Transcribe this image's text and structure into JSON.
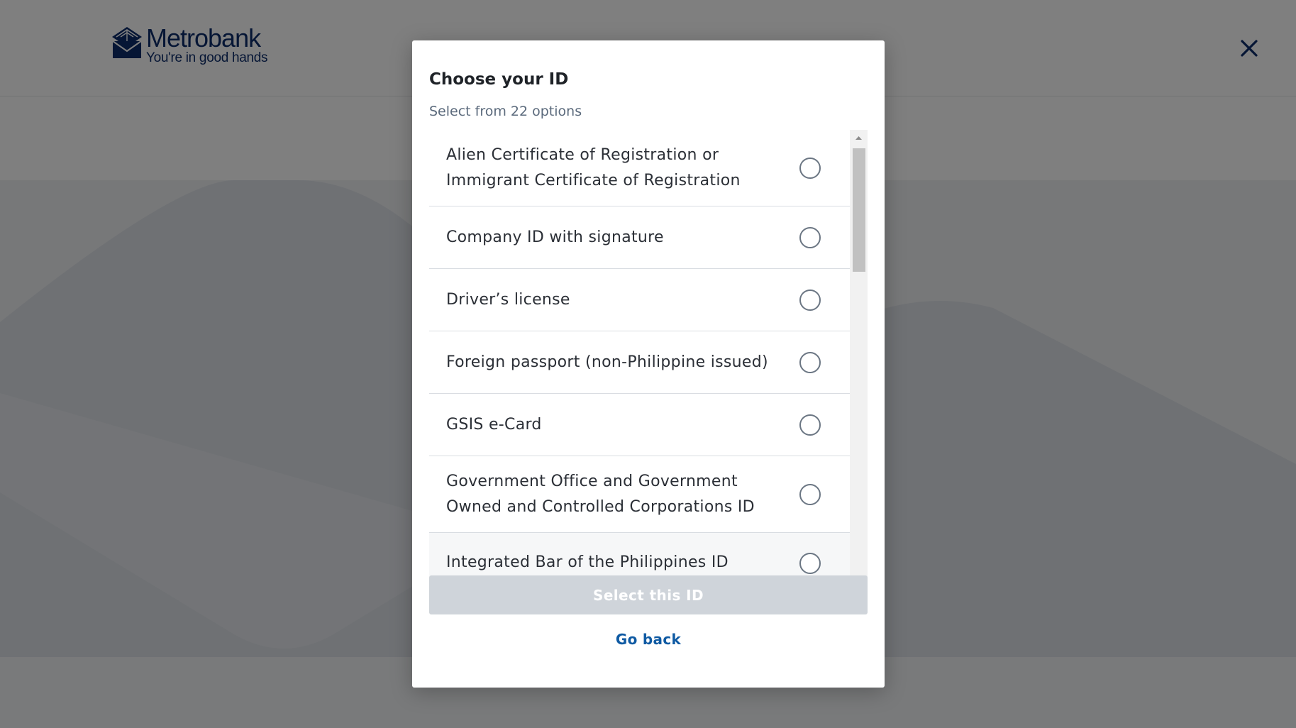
{
  "header": {
    "logo_name": "Metrobank",
    "logo_tagline": "You're in good hands",
    "close_icon": "close-icon"
  },
  "modal": {
    "title": "Choose your ID",
    "subtitle": "Select from 22 options",
    "options": [
      {
        "label": "Alien Certificate of Registration or Immigrant Certificate of Registration",
        "selected": false
      },
      {
        "label": "Company ID with signature",
        "selected": false
      },
      {
        "label": "Driver’s license",
        "selected": false
      },
      {
        "label": "Foreign passport (non-Philippine issued)",
        "selected": false
      },
      {
        "label": "GSIS e-Card",
        "selected": false
      },
      {
        "label": "Government Office and Government Owned and Controlled Corporations ID",
        "selected": false
      },
      {
        "label": "Integrated Bar of the Philippines ID",
        "selected": false
      }
    ],
    "select_button": "Select this ID",
    "go_back": "Go back"
  },
  "colors": {
    "brand": "#0d2c6b",
    "link": "#0f5aa3",
    "button_disabled": "#cfd4da"
  }
}
